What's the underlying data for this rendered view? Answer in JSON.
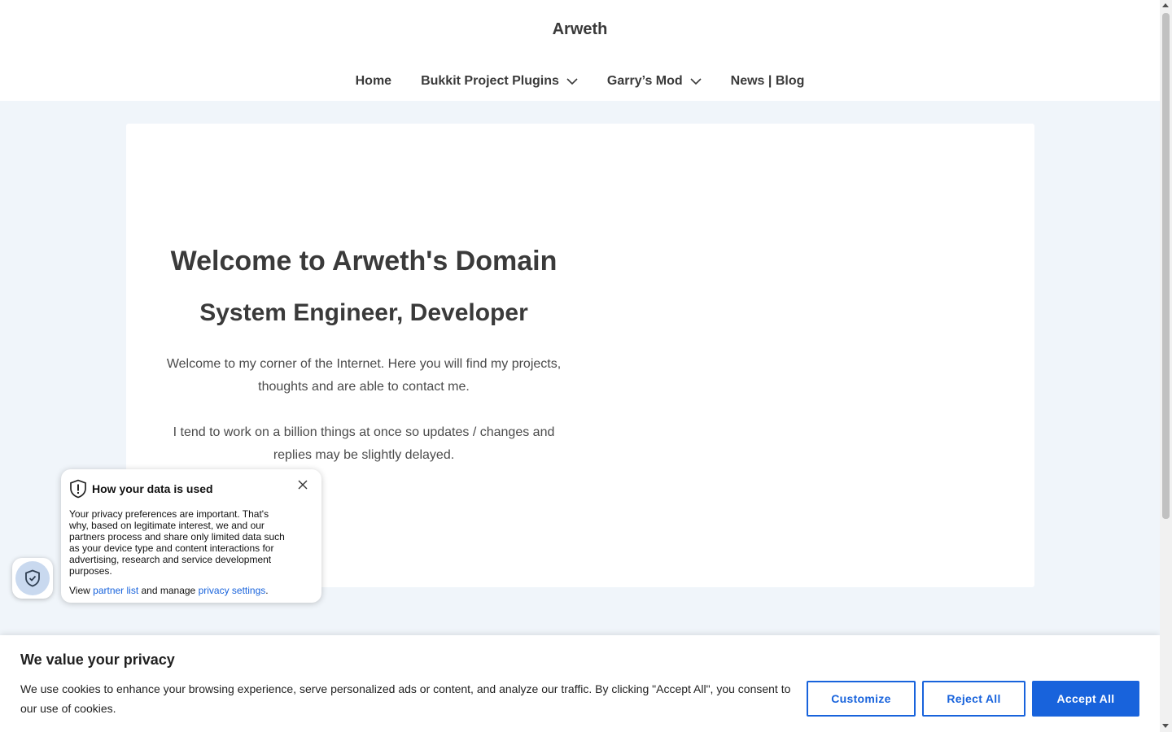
{
  "header": {
    "site_title": "Arweth",
    "nav": [
      {
        "label": "Home",
        "has_dropdown": false
      },
      {
        "label": "Bukkit Project Plugins",
        "has_dropdown": true
      },
      {
        "label": "Garry’s Mod",
        "has_dropdown": true
      },
      {
        "label": "News | Blog",
        "has_dropdown": false
      }
    ]
  },
  "hero": {
    "title": "Welcome to Arweth's Domain",
    "subtitle": "System Engineer, Developer",
    "paragraph_1": "Welcome to my corner of the Internet. Here you will find my projects, thoughts and are able to contact me.",
    "paragraph_2": "I tend to work on a billion things at once so updates / changes and replies may be slightly delayed."
  },
  "privacy_popup": {
    "title": "How your data is used",
    "body": "Your privacy preferences are important. That's why, based on legitimate interest, we and our partners process and share only limited data such as your device type and content interactions for advertising, research and service development purposes.",
    "links_prefix": "View ",
    "partner_list_label": "partner list",
    "links_middle": " and manage ",
    "privacy_settings_label": "privacy settings",
    "links_suffix": "."
  },
  "consent_banner": {
    "title": "We value your privacy",
    "text": "We use cookies to enhance your browsing experience, serve personalized ads or content, and analyze our traffic. By clicking \"Accept All\", you consent to our use of cookies.",
    "customize_label": "Customize",
    "reject_label": "Reject All",
    "accept_label": "Accept All"
  },
  "colors": {
    "accent": "#1863dc",
    "page_background": "#f0f5fa",
    "text": "#3a3a3a"
  }
}
